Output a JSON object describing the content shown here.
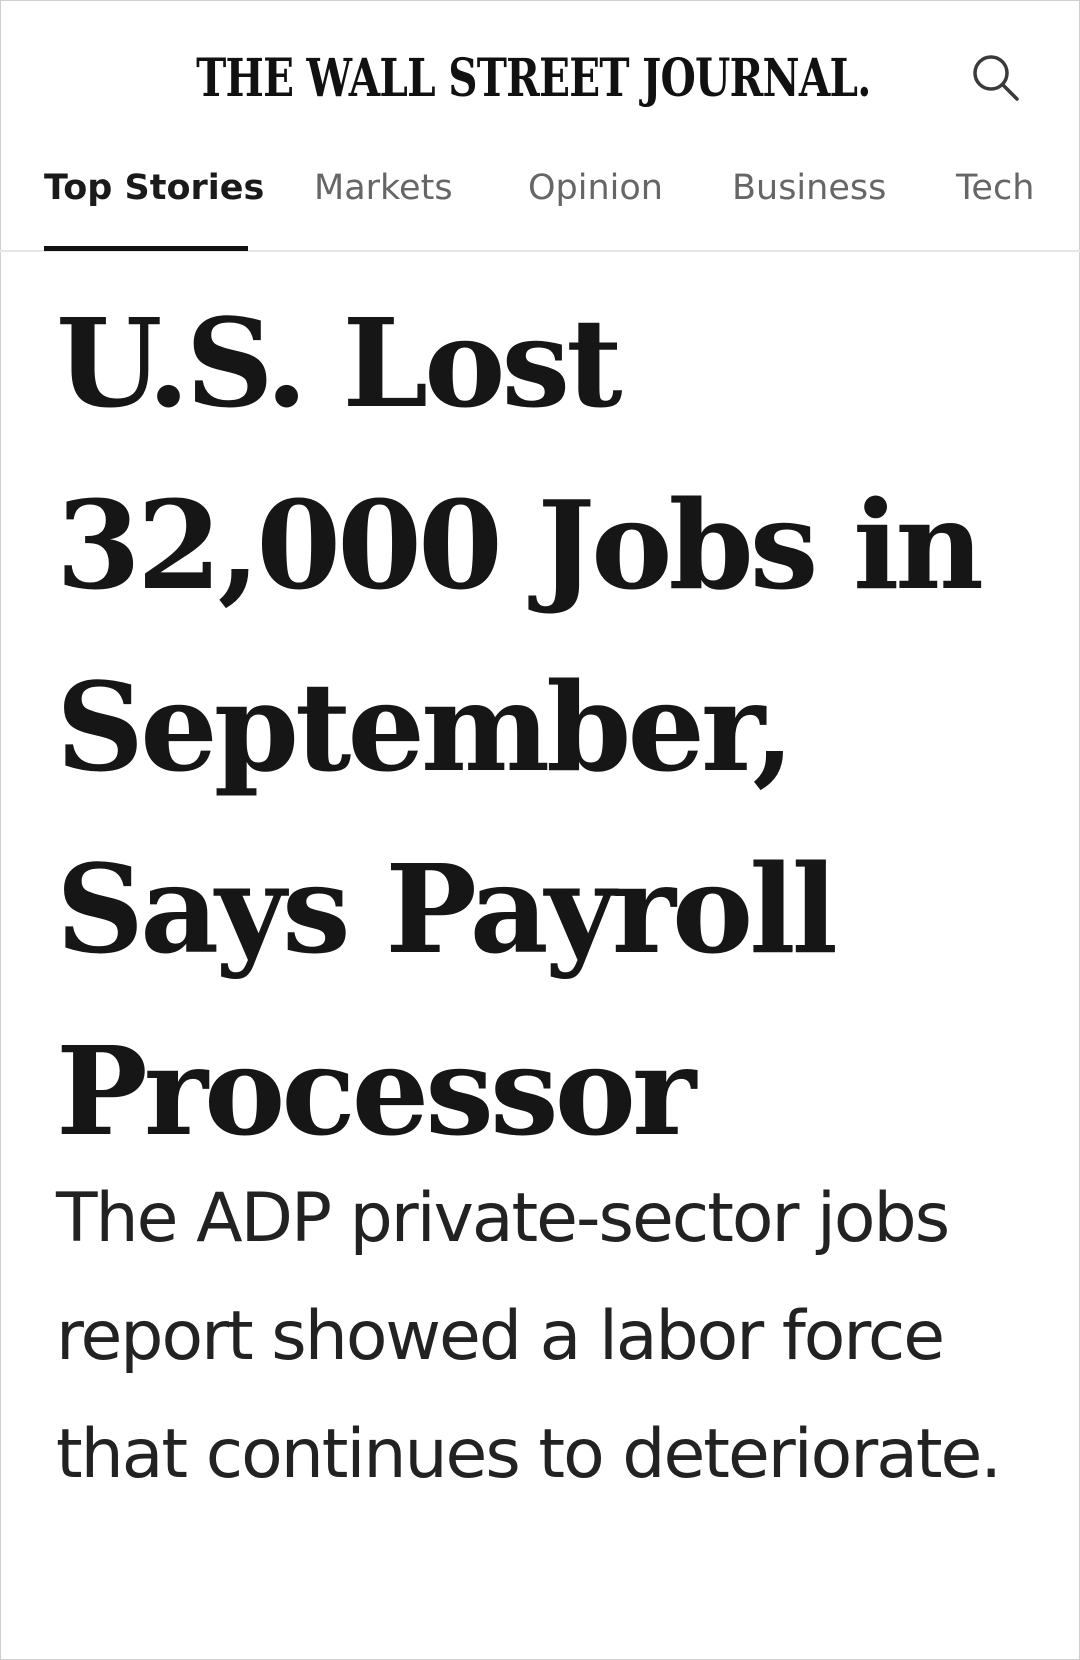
{
  "masthead": {
    "logo_text": "THE WALL STREET JOURNAL.",
    "search_icon": "search-icon"
  },
  "nav": {
    "active_index": 0,
    "tabs": [
      {
        "label": "Top Stories"
      },
      {
        "label": "Markets"
      },
      {
        "label": "Opinion"
      },
      {
        "label": "Business"
      },
      {
        "label": "Tech"
      }
    ]
  },
  "article": {
    "headline": "U.S. Lost 32,000 Jobs in September, Says Payroll Processor",
    "dek": "The ADP private-sector jobs report showed a labor force that continues to deteriorate."
  }
}
